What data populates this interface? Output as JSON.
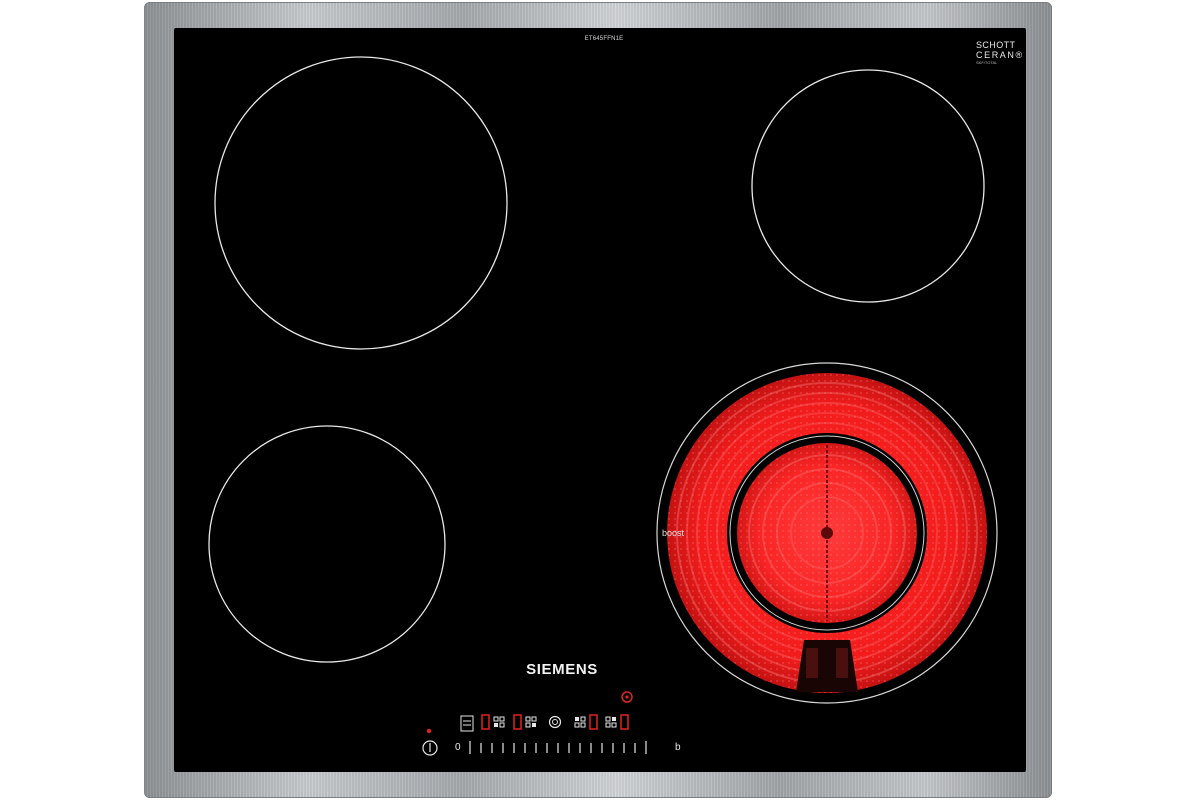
{
  "product": {
    "model_code": "ET645FFN1E",
    "certification_brand": [
      "SCHOTT",
      "CERAN",
      "®"
    ],
    "certification_fine_print": "SKF/TOTAL",
    "brand": "SIEMENS"
  },
  "zones": {
    "boost_label": "boost",
    "active_color": "#ff2a2a"
  },
  "controls": {
    "power_symbol": "power-icon",
    "slider_start_label": "0",
    "slider_end_label": "b",
    "boost_key_label": "b",
    "indicator_color": "#e0241f"
  },
  "colors": {
    "glass": "#000000",
    "frame": "#b4b8bb",
    "text": "#e6e6e6"
  }
}
